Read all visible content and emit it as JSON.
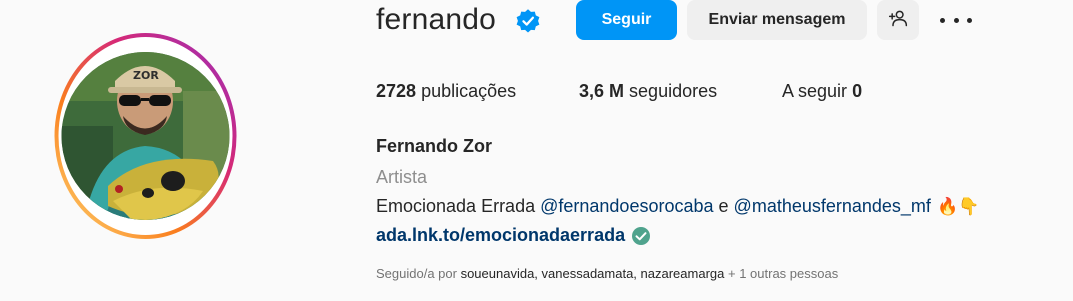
{
  "profile": {
    "username": "fernando",
    "verified_icon": "verified-badge-icon",
    "full_name": "Fernando Zor",
    "category": "Artista",
    "bio": {
      "title": "Emocionada Errada",
      "mention1": "@fernandoesorocaba",
      "conjunction": "e",
      "mention2": "@matheusfernandes_mf",
      "emojis": "🔥👇"
    },
    "link": "ada.lnk.to/emocionadaerrada",
    "link_icon": "verified-check-icon"
  },
  "actions": {
    "follow_label": "Seguir",
    "message_label": "Enviar mensagem",
    "suggest_icon": "person-add-icon",
    "more_icon": "more-options-icon"
  },
  "stats": {
    "posts_count": "2728",
    "posts_label": "publicações",
    "followers_count": "3,6 M",
    "followers_label": "seguidores",
    "following_label": "A seguir",
    "following_count": "0"
  },
  "followed_by": {
    "prefix": "Seguido/a por",
    "names": "soueunavida, vanessadamata, nazareamarga",
    "suffix": "+ 1 outras pessoas"
  },
  "colors": {
    "accent": "#0095f6",
    "link": "#00376b",
    "muted": "#8e8e8e",
    "background": "#fafafa"
  }
}
